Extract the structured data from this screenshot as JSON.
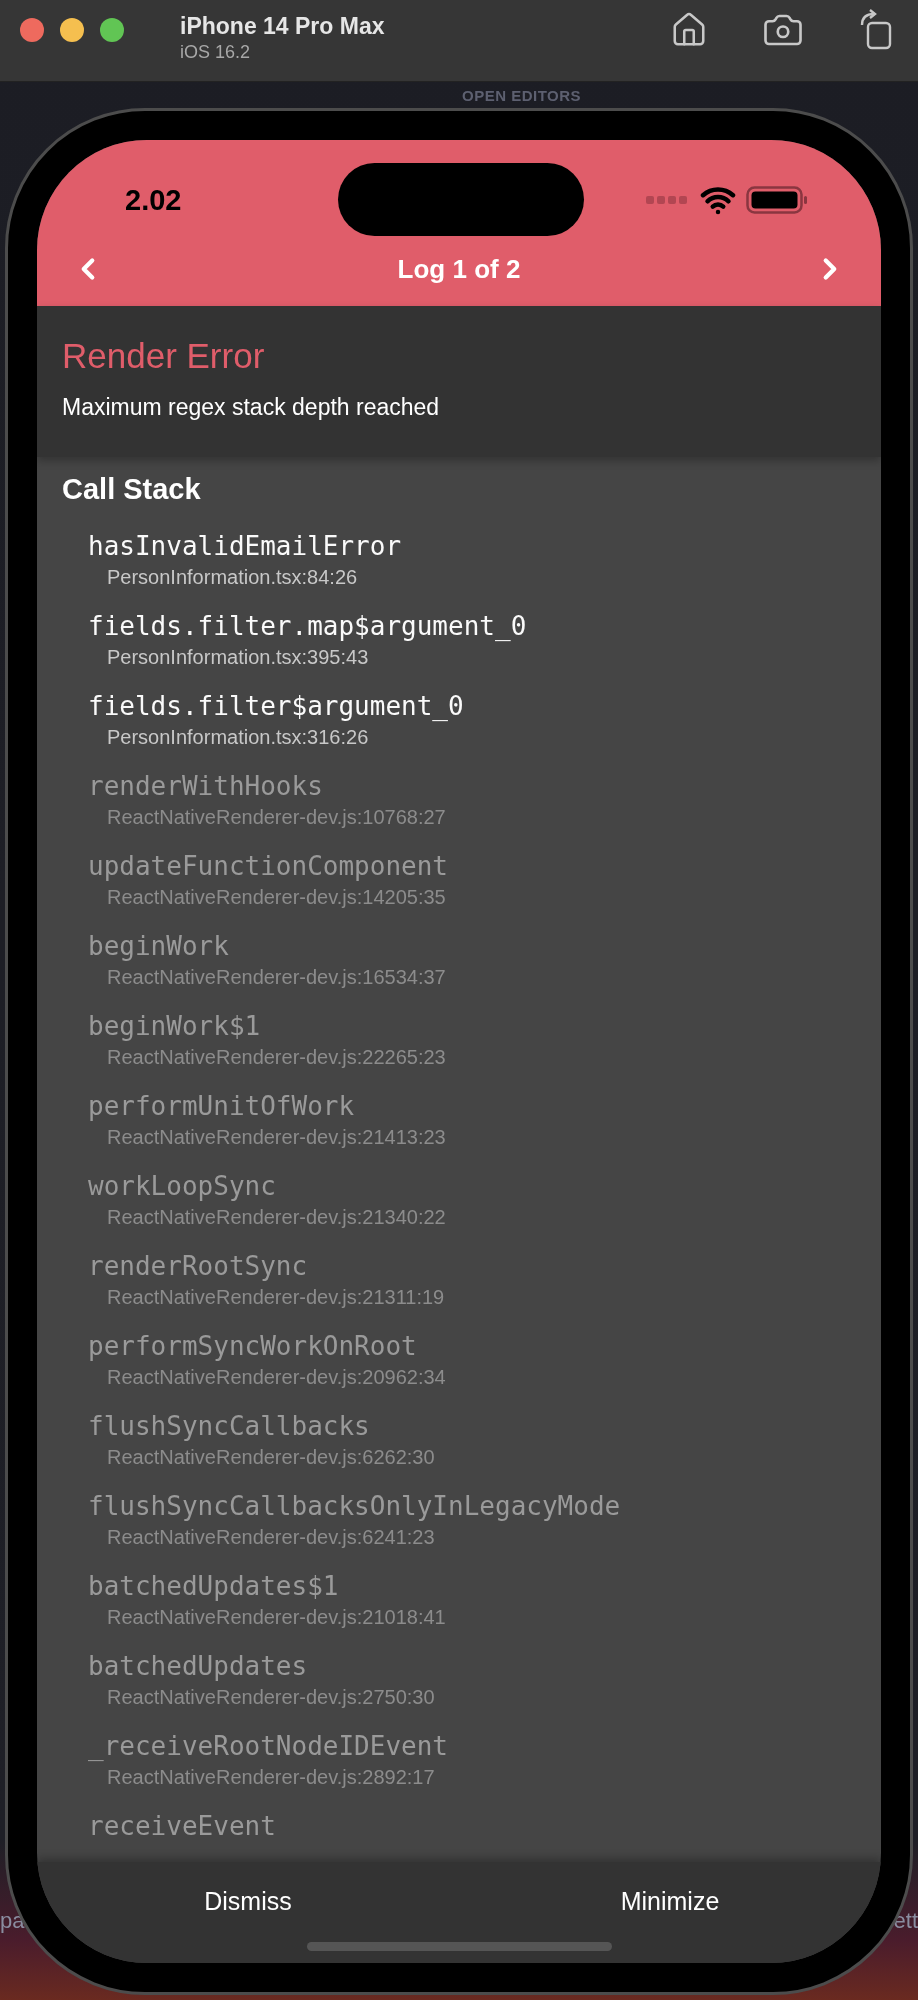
{
  "simulator": {
    "device": "iPhone 14 Pro Max",
    "os": "iOS 16.2"
  },
  "background": {
    "panel_title": "OPEN EDITORS",
    "left_fragment": "pa",
    "right_fragment": "ett"
  },
  "status_bar": {
    "time": "2.02"
  },
  "log_header": {
    "title": "Log 1 of 2"
  },
  "error": {
    "title": "Render Error",
    "message": "Maximum regex stack depth reached"
  },
  "call_stack": {
    "title": "Call Stack",
    "frames": [
      {
        "name": "hasInvalidEmailError",
        "location": "PersonInformation.tsx:84:26",
        "dimmed": false
      },
      {
        "name": "fields.filter.map$argument_0",
        "location": "PersonInformation.tsx:395:43",
        "dimmed": false
      },
      {
        "name": "fields.filter$argument_0",
        "location": "PersonInformation.tsx:316:26",
        "dimmed": false
      },
      {
        "name": "renderWithHooks",
        "location": "ReactNativeRenderer-dev.js:10768:27",
        "dimmed": true
      },
      {
        "name": "updateFunctionComponent",
        "location": "ReactNativeRenderer-dev.js:14205:35",
        "dimmed": true
      },
      {
        "name": "beginWork",
        "location": "ReactNativeRenderer-dev.js:16534:37",
        "dimmed": true
      },
      {
        "name": "beginWork$1",
        "location": "ReactNativeRenderer-dev.js:22265:23",
        "dimmed": true
      },
      {
        "name": "performUnitOfWork",
        "location": "ReactNativeRenderer-dev.js:21413:23",
        "dimmed": true
      },
      {
        "name": "workLoopSync",
        "location": "ReactNativeRenderer-dev.js:21340:22",
        "dimmed": true
      },
      {
        "name": "renderRootSync",
        "location": "ReactNativeRenderer-dev.js:21311:19",
        "dimmed": true
      },
      {
        "name": "performSyncWorkOnRoot",
        "location": "ReactNativeRenderer-dev.js:20962:34",
        "dimmed": true
      },
      {
        "name": "flushSyncCallbacks",
        "location": "ReactNativeRenderer-dev.js:6262:30",
        "dimmed": true
      },
      {
        "name": "flushSyncCallbacksOnlyInLegacyMode",
        "location": "ReactNativeRenderer-dev.js:6241:23",
        "dimmed": true
      },
      {
        "name": "batchedUpdates$1",
        "location": "ReactNativeRenderer-dev.js:21018:41",
        "dimmed": true
      },
      {
        "name": "batchedUpdates",
        "location": "ReactNativeRenderer-dev.js:2750:30",
        "dimmed": true
      },
      {
        "name": "_receiveRootNodeIDEvent",
        "location": "ReactNativeRenderer-dev.js:2892:17",
        "dimmed": true
      },
      {
        "name": "receiveEvent",
        "dimmed": true
      }
    ]
  },
  "footer": {
    "buttons": [
      "Dismiss",
      "Minimize"
    ]
  }
}
